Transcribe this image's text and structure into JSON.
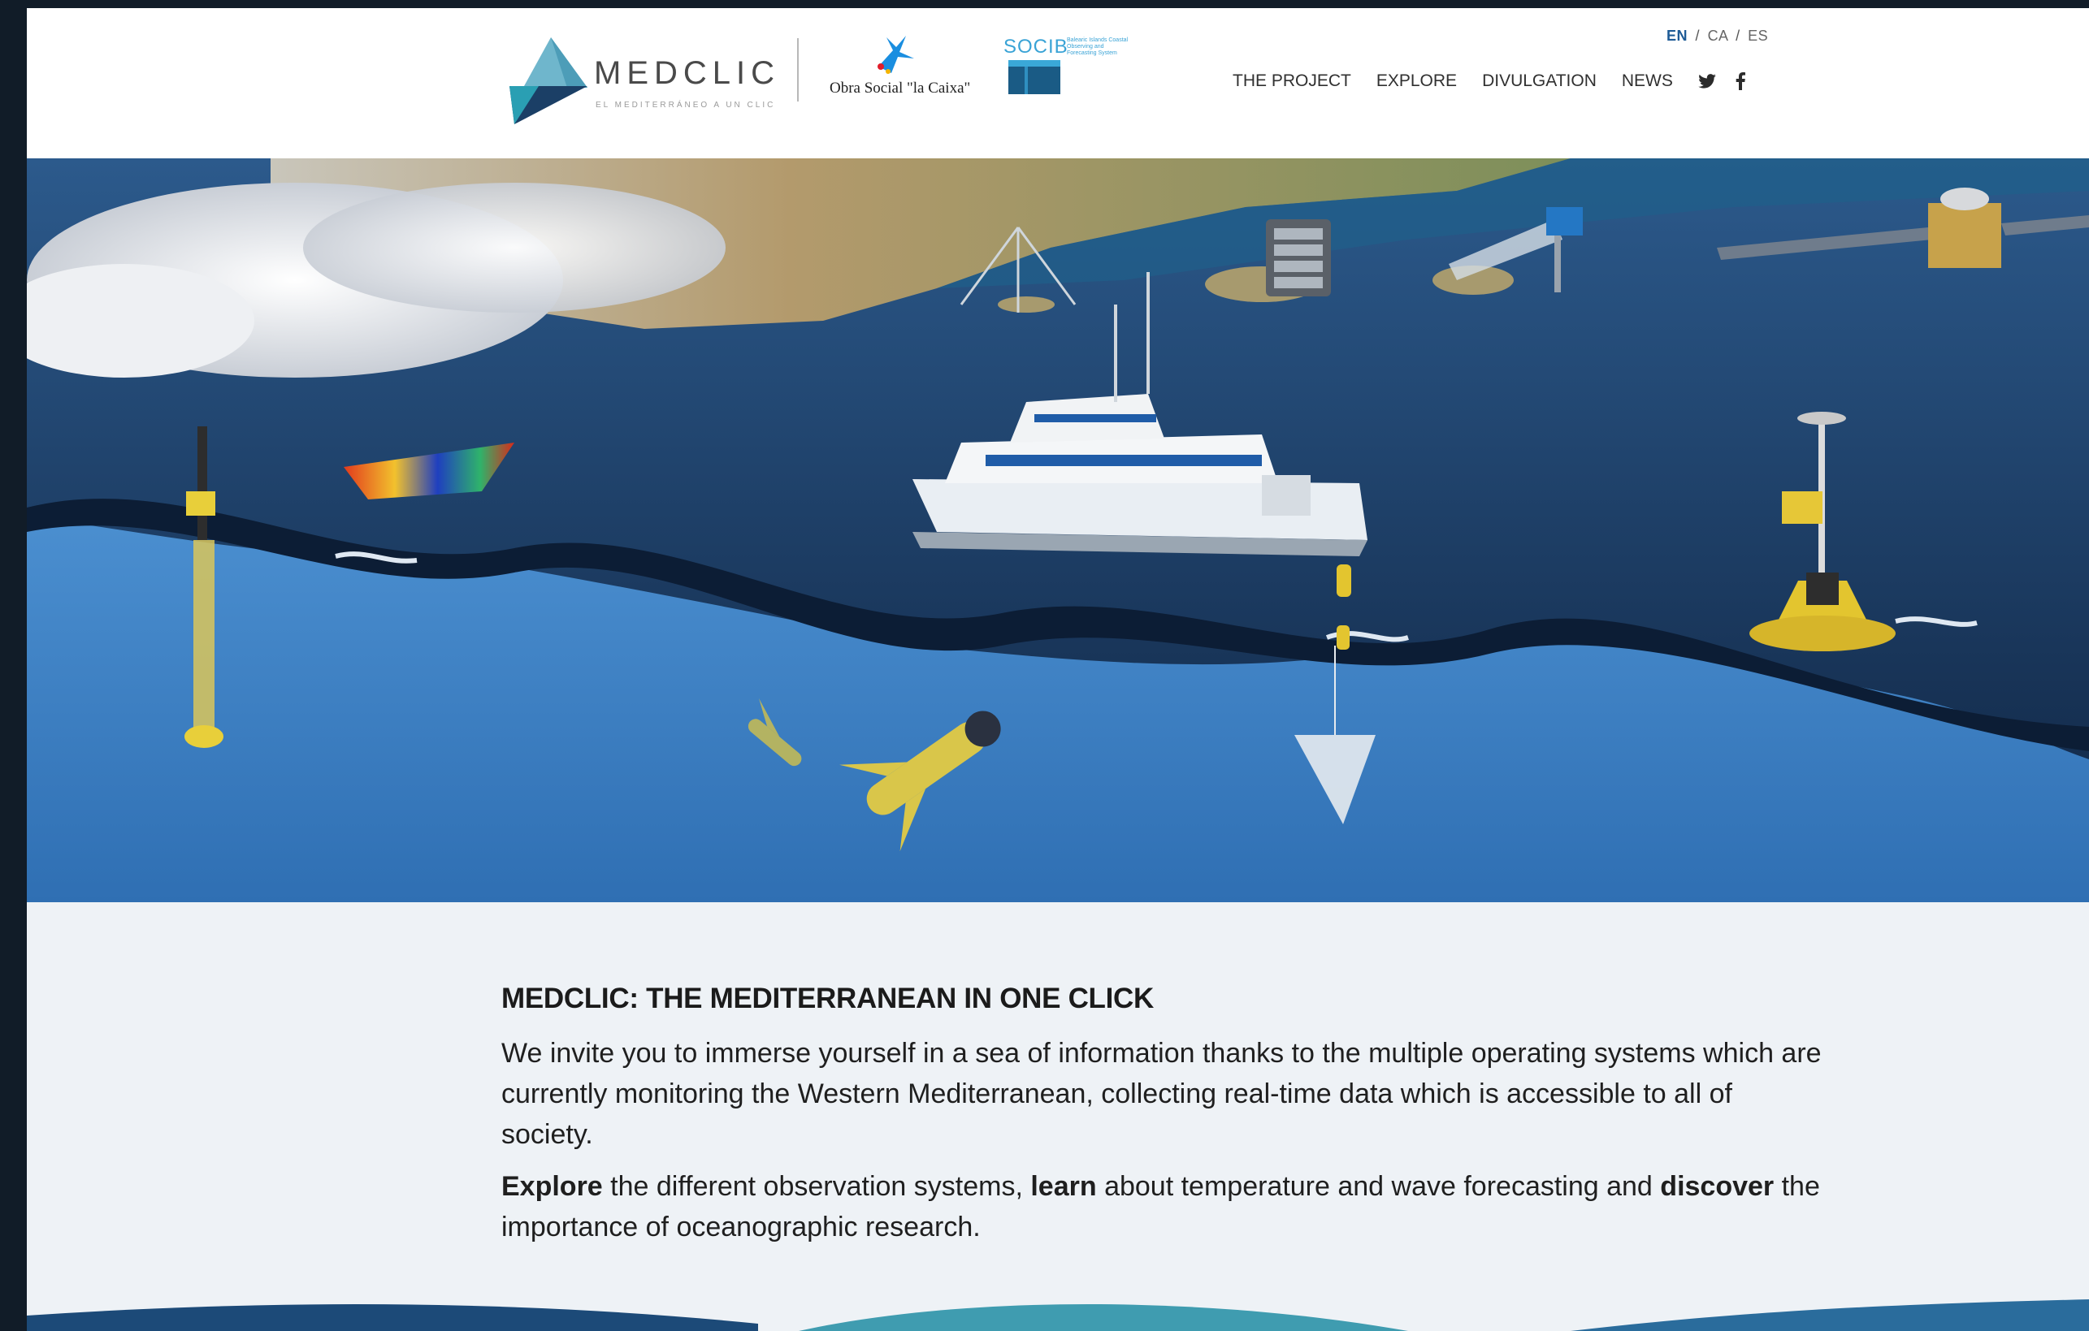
{
  "header": {
    "brand": {
      "name": "MEDCLIC",
      "tagline": "EL MEDITERRÁNEO A UN CLIC"
    },
    "partners": {
      "caixa": "Obra Social \"la Caixa\"",
      "socib": {
        "name": "SOCIB",
        "description": "Balearic Islands Coastal Observing and Forecasting System"
      }
    },
    "languages": {
      "active": "EN",
      "others": [
        "CA",
        "ES"
      ],
      "separator": "/"
    },
    "nav": {
      "items": [
        "THE PROJECT",
        "EXPLORE",
        "DIVULGATION",
        "NEWS"
      ],
      "icons": [
        "twitter-icon",
        "facebook-icon"
      ]
    }
  },
  "main": {
    "title": "MEDCLIC: THE MEDITERRANEAN IN ONE CLICK",
    "intro": "We invite you to immerse yourself in a sea of information thanks to the multiple operating systems which are currently monitoring the Western Mediterranean, collecting real-time data which is accessible to all of society.",
    "cta": {
      "w1": "Explore",
      "t1": " the different observation systems, ",
      "w2": "learn",
      "t2": " about temperature and wave forecasting and ",
      "w3": "discover",
      "t3": " the importance of oceanographic research."
    }
  },
  "colors": {
    "brand_teal": "#2a9fb3",
    "brand_dark": "#1b3f66",
    "nav_text": "#303030",
    "active_lang": "#1e5b96",
    "socib_blue": "#39a3d6",
    "page_bg": "#eef2f6"
  }
}
